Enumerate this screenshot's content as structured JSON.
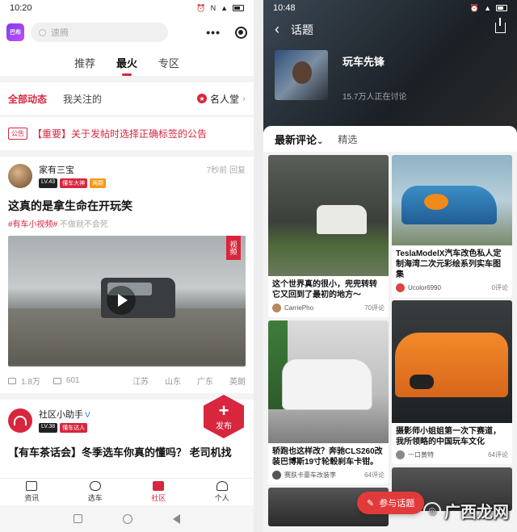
{
  "left": {
    "status": {
      "time": "10:20"
    },
    "header": {
      "logo_text": "巴布",
      "search_placeholder": "速腾"
    },
    "tabs": [
      "推荐",
      "最火",
      "专区"
    ],
    "subtabs": {
      "all": "全部动态",
      "following": "我关注的",
      "hall": "名人堂"
    },
    "notice": {
      "tag": "公告",
      "text": "【重要】关于发帖时选择正确标签的公告"
    },
    "post1": {
      "user": "家有三宝",
      "level": "LV.43",
      "badge1": "懂车大神",
      "badge2": "两颗",
      "time": "7秒前 回复",
      "title": "这真的是拿生命在开玩笑",
      "tag_red": "#有车小视频#",
      "tag_gray": "不做就不会死",
      "video_tag": "视频",
      "views": "1.8万",
      "comments": "601",
      "regions": [
        "江苏",
        "山东",
        "广东",
        "英朗"
      ]
    },
    "post2": {
      "user": "社区小助手",
      "verified": "V",
      "level": "LV.38",
      "badge": "懂车达人",
      "title": "【有车茶话会】冬季选车你真的懂吗？ 老司机找"
    },
    "fab": {
      "plus": "+",
      "label": "发布"
    },
    "nav": [
      "资讯",
      "选车",
      "社区",
      "个人"
    ],
    "accent": "#d7263d"
  },
  "right": {
    "status": {
      "time": "10:48"
    },
    "header": {
      "back": "‹",
      "title": "话题"
    },
    "topic": {
      "name": "玩车先锋",
      "count": "15.7万人正在讨论"
    },
    "tabs": {
      "latest": "最新评论",
      "arrow": "⌄",
      "featured": "精选"
    },
    "cards": [
      {
        "title": "这个世界真的很小，兜兜转转它又回到了最初的地方～",
        "author": "CarriePho",
        "comments": "70评论"
      },
      {
        "title": "TeslaModelX汽车改色私人定制海湾二次元彩绘系列实车图集",
        "author": "Ucolor6990",
        "comments": "0评论"
      },
      {
        "title": "轿跑也这样改？奔驰CLS260改装巴博斯19寸轮毂刹车卡钳。",
        "author": "赛肤卡豪车改装李",
        "comments": "64评论"
      },
      {
        "title": "摄影师小姐姐第一次下赛道，我所领略的中国玩车文化",
        "author": "一口黄特",
        "comments": "64评论"
      }
    ],
    "join_button": "参与话题",
    "watermark": "广西龙网"
  }
}
